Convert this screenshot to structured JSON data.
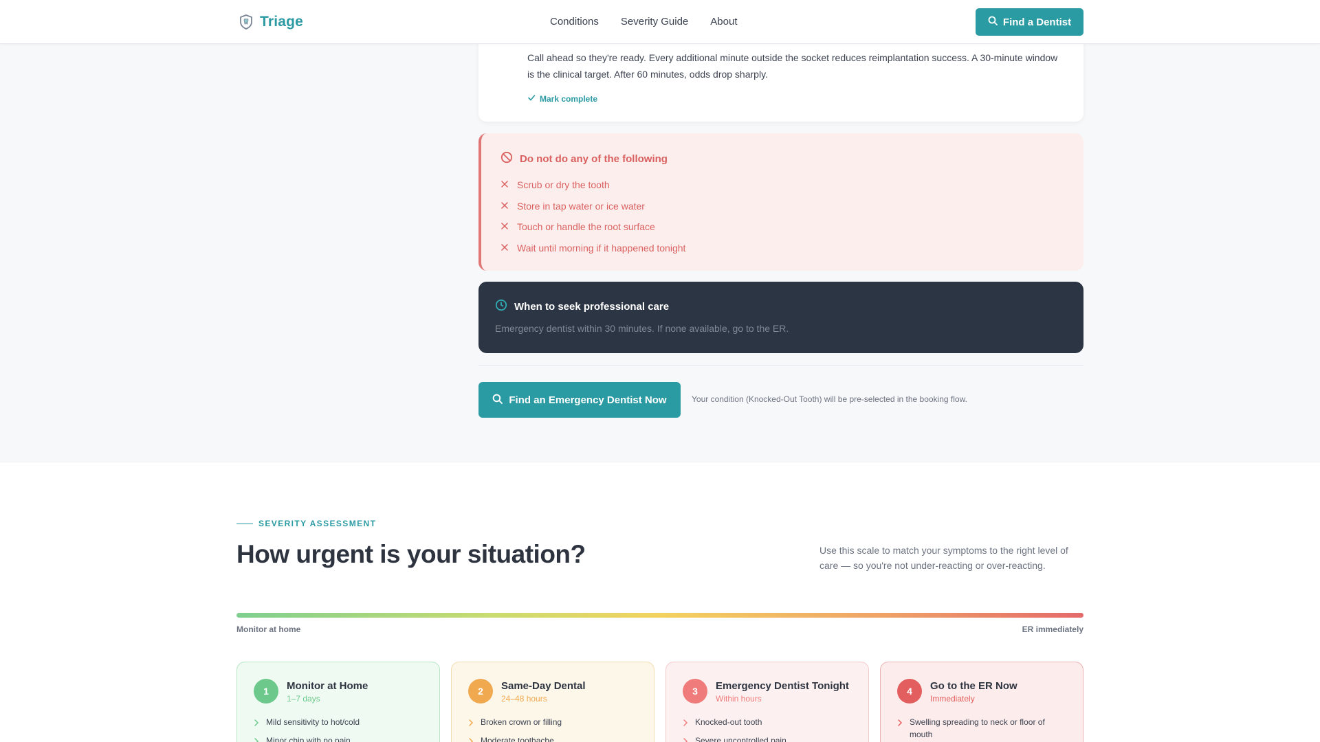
{
  "header": {
    "brand": "Triage",
    "nav": [
      "Conditions",
      "Severity Guide",
      "About"
    ],
    "cta_label": "Find a Dentist"
  },
  "step": {
    "text": "Call ahead so they're ready. Every additional minute outside the socket reduces reimplantation success. A 30-minute window is the clinical target. After 60 minutes, odds drop sharply.",
    "mark_complete": "Mark complete"
  },
  "warning": {
    "title": "Do not do any of the following",
    "items": [
      "Scrub or dry the tooth",
      "Store in tap water or ice water",
      "Touch or handle the root surface",
      "Wait until morning if it happened tonight"
    ]
  },
  "care": {
    "title": "When to seek professional care",
    "text": "Emergency dentist within 30 minutes. If none available, go to the ER."
  },
  "emergency": {
    "button_label": "Find an Emergency Dentist Now",
    "note": "Your condition (Knocked-Out Tooth) will be pre-selected in the booking flow."
  },
  "severity": {
    "eyebrow": "SEVERITY ASSESSMENT",
    "headline": "How urgent is your situation?",
    "intro": "Use this scale to match your symptoms to the right level of care — so you're not under-reacting or over-reacting.",
    "scale_left": "Monitor at home",
    "scale_right": "ER immediately",
    "tiers": [
      {
        "number": "1",
        "name": "Monitor at Home",
        "timeframe": "1–7 days",
        "color": "#6cc98b",
        "items": [
          "Mild sensitivity to hot/cold",
          "Minor chip with no pain"
        ]
      },
      {
        "number": "2",
        "name": "Same-Day Dental",
        "timeframe": "24–48 hours",
        "color": "#f0a94f",
        "items": [
          "Broken crown or filling",
          "Moderate toothache"
        ]
      },
      {
        "number": "3",
        "name": "Emergency Dentist Tonight",
        "timeframe": "Within hours",
        "color": "#ef7b7b",
        "items": [
          "Knocked-out tooth",
          "Severe uncontrolled pain"
        ]
      },
      {
        "number": "4",
        "name": "Go to the ER Now",
        "timeframe": "Immediately",
        "color": "#e35f5f",
        "items": [
          "Swelling spreading to neck or floor of mouth"
        ]
      }
    ]
  },
  "colors": {
    "accent": "#2a9aa3",
    "danger": "#d9605f",
    "dark_card": "#2c3543"
  },
  "icons": {
    "brand": "shield-tooth-icon",
    "search": "search-icon",
    "check": "check-icon",
    "ban": "ban-icon",
    "close": "x-icon",
    "clock": "clock-icon",
    "chevron": "chevron-right-icon"
  }
}
